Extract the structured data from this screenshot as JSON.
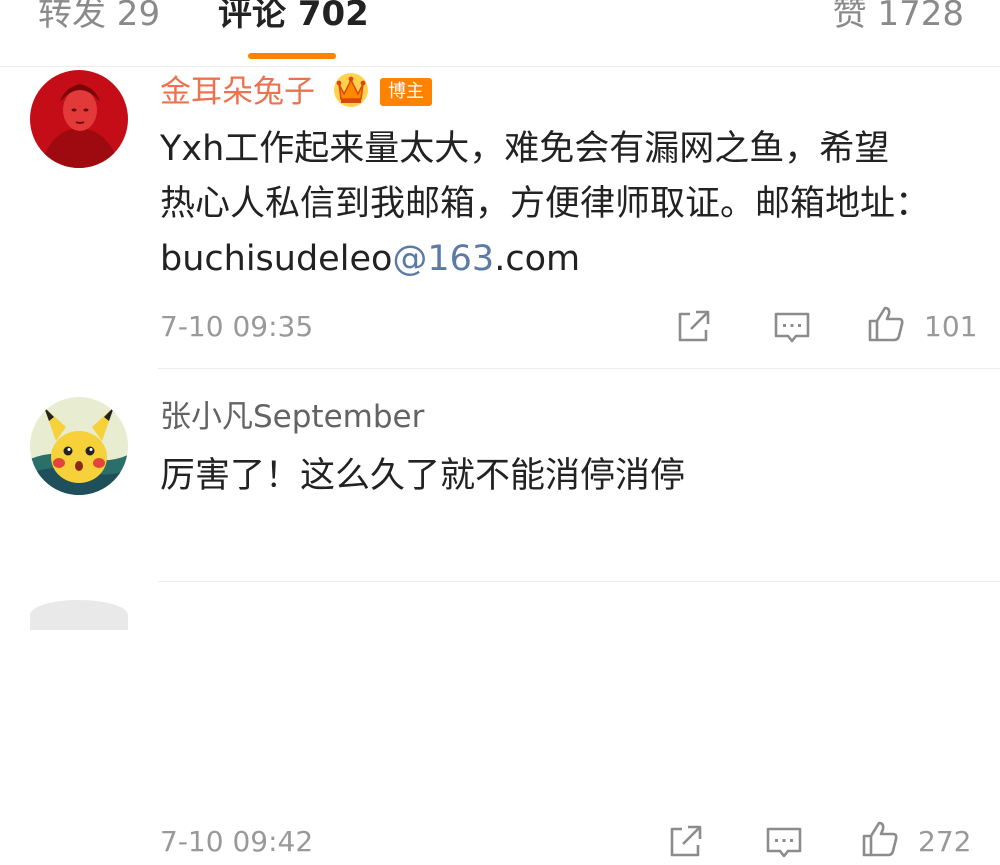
{
  "tabs": {
    "repost": "转发 29",
    "comments": "评论 702",
    "likes": "赞 1728"
  },
  "accent_color": "#ff8200",
  "comments": [
    {
      "username": "金耳朵兔子",
      "badge": "博主",
      "text_line1": "Yxh工作起来量太大，难免会有漏网之鱼，希望",
      "text_line2": "热心人私信到我邮箱，方便律师取证。邮箱地址：",
      "text_line3_prefix": "buchisudeleo",
      "text_line3_link": "@163",
      "text_line3_suffix": ".com",
      "time": "7-10 09:35",
      "likes": "101"
    },
    {
      "username": "张小凡September",
      "text_line1": "厉害了！这么久了就不能消停消停",
      "time": "7-10 09:42",
      "likes": "272"
    }
  ],
  "icons": {
    "share": "share-icon",
    "reply": "comment-icon",
    "like": "thumbs-up-icon",
    "crown": "crown-icon"
  }
}
